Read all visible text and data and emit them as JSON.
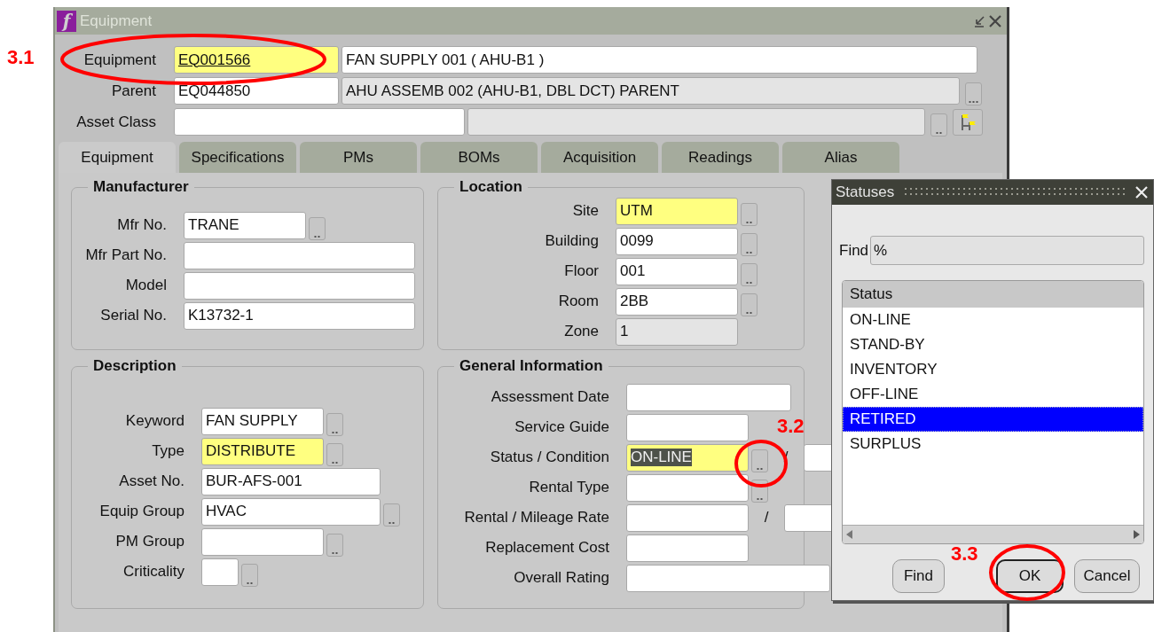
{
  "window": {
    "title": "Equipment",
    "app_icon": "f"
  },
  "header": {
    "fields": [
      {
        "label": "Equipment",
        "code": "EQ001566",
        "description": "FAN SUPPLY 001 ( AHU-B1 )",
        "required": true,
        "focused": true,
        "description_disabled": false,
        "lov": false,
        "hierarchy_button": false
      },
      {
        "label": "Parent",
        "code": "EQ044850",
        "description": "AHU ASSEMB 002 (AHU-B1, DBL DCT) PARENT",
        "required": false,
        "focused": false,
        "description_disabled": true,
        "lov": true,
        "hierarchy_button": false
      },
      {
        "label": "Asset Class",
        "required": false,
        "focused": false,
        "description_disabled": true,
        "lov": true,
        "hierarchy_button": true
      }
    ]
  },
  "tabs": [
    {
      "label": "Equipment",
      "selected": true
    },
    {
      "label": "Specifications",
      "selected": false
    },
    {
      "label": "PMs",
      "selected": false
    },
    {
      "label": "BOMs",
      "selected": false
    },
    {
      "label": "Acquisition",
      "selected": false
    },
    {
      "label": "Readings",
      "selected": false
    },
    {
      "label": "Alias",
      "selected": false
    }
  ],
  "panels": [
    {
      "title": "Manufacturer",
      "fields": [
        {
          "label": "Mfr No.",
          "value": "TRANE",
          "lov": true,
          "required": false,
          "disabled": false
        },
        {
          "label": "Mfr Part No.",
          "lov": false,
          "required": false,
          "disabled": false
        },
        {
          "label": "Model",
          "lov": false,
          "required": false,
          "disabled": false
        },
        {
          "label": "Serial No.",
          "value": "K13732-1",
          "lov": false,
          "required": false,
          "disabled": false
        }
      ]
    },
    {
      "title": "Location",
      "fields": [
        {
          "label": "Site",
          "value": "UTM",
          "lov": true,
          "required": true,
          "disabled": false
        },
        {
          "label": "Building",
          "value": "0099",
          "lov": true,
          "required": false,
          "disabled": false
        },
        {
          "label": "Floor",
          "value": "001",
          "lov": true,
          "required": false,
          "disabled": false
        },
        {
          "label": "Room",
          "value": "2BB",
          "lov": true,
          "required": false,
          "disabled": false
        },
        {
          "label": "Zone",
          "value": "1",
          "lov": false,
          "required": false,
          "disabled": true
        }
      ]
    },
    {
      "title": "Description",
      "fields": [
        {
          "label": "Keyword",
          "value": "FAN SUPPLY",
          "lov": true,
          "required": false,
          "disabled": false
        },
        {
          "label": "Type",
          "value": "DISTRIBUTE",
          "lov": true,
          "required": true,
          "disabled": false
        },
        {
          "label": "Asset No.",
          "value": "BUR-AFS-001",
          "lov": false,
          "required": false,
          "disabled": false
        },
        {
          "label": "Equip Group",
          "value": "HVAC",
          "lov": true,
          "required": false,
          "disabled": false
        },
        {
          "label": "PM Group",
          "lov": true,
          "required": false,
          "disabled": false
        },
        {
          "label": "Criticality",
          "lov": true,
          "required": false,
          "disabled": false
        }
      ]
    },
    {
      "title": "General Information",
      "fields": [
        {
          "label": "Assessment Date",
          "lov": false,
          "required": false,
          "disabled": false
        },
        {
          "label": "Service Guide",
          "lov": false,
          "required": false,
          "disabled": false
        },
        {
          "label": "Status / Condition",
          "value": "ON-LINE",
          "text_selected": true,
          "lov": true,
          "required": true,
          "disabled": false,
          "separator": "/"
        },
        {
          "label": "Rental Type",
          "lov": true,
          "required": false,
          "disabled": false
        },
        {
          "label": "Rental / Mileage Rate",
          "lov": false,
          "required": false,
          "disabled": false,
          "separator": "/"
        },
        {
          "label": "Replacement Cost",
          "lov": false,
          "required": false,
          "disabled": false
        },
        {
          "label": "Overall Rating",
          "required": false,
          "disabled": false
        }
      ]
    }
  ],
  "dialog": {
    "title": "Statuses",
    "find_label": "Find",
    "find_value": "%",
    "column": "Status",
    "items": [
      {
        "label": "ON-LINE",
        "selected": false
      },
      {
        "label": "STAND-BY",
        "selected": false
      },
      {
        "label": "INVENTORY",
        "selected": false
      },
      {
        "label": "OFF-LINE",
        "selected": false
      },
      {
        "label": "RETIRED",
        "selected": true
      },
      {
        "label": "SURPLUS",
        "selected": false
      }
    ],
    "buttons": [
      {
        "label": "Find",
        "default": false
      },
      {
        "label": "OK",
        "default": true
      },
      {
        "label": "Cancel",
        "default": false
      }
    ]
  },
  "annotations": [
    {
      "label": "3.1"
    },
    {
      "label": "3.2"
    },
    {
      "label": "3.3"
    }
  ]
}
